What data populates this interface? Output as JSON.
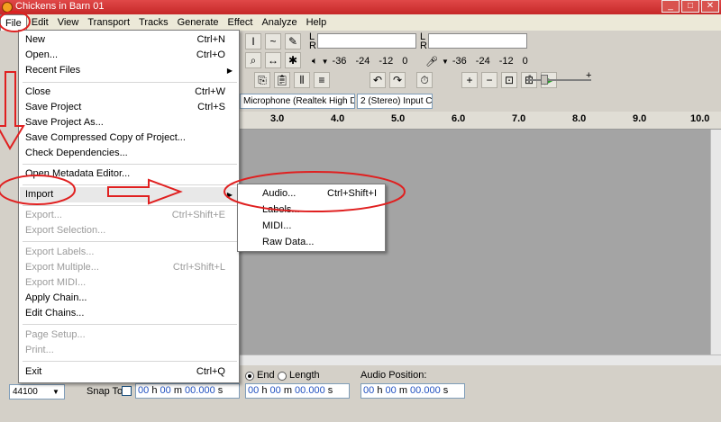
{
  "window": {
    "title": "Chickens in Barn 01",
    "buttons": [
      "_",
      "□",
      "✕"
    ]
  },
  "menubar": [
    "File",
    "Edit",
    "View",
    "Transport",
    "Tracks",
    "Generate",
    "Effect",
    "Analyze",
    "Help"
  ],
  "file_menu": {
    "items": [
      {
        "label": "New",
        "shortcut": "Ctrl+N",
        "enabled": true
      },
      {
        "label": "Open...",
        "shortcut": "Ctrl+O",
        "enabled": true
      },
      {
        "label": "Recent Files",
        "shortcut": "",
        "enabled": true,
        "submenu": true
      },
      {
        "label": "Close",
        "shortcut": "Ctrl+W",
        "enabled": true
      },
      {
        "label": "Save Project",
        "shortcut": "Ctrl+S",
        "enabled": true
      },
      {
        "label": "Save Project As...",
        "shortcut": "",
        "enabled": true
      },
      {
        "label": "Save Compressed Copy of Project...",
        "shortcut": "",
        "enabled": true
      },
      {
        "label": "Check Dependencies...",
        "shortcut": "",
        "enabled": true
      },
      {
        "label": "Open Metadata Editor...",
        "shortcut": "",
        "enabled": true
      },
      {
        "label": "Import",
        "shortcut": "",
        "enabled": true,
        "submenu": true
      },
      {
        "label": "Export...",
        "shortcut": "Ctrl+Shift+E",
        "enabled": false
      },
      {
        "label": "Export Selection...",
        "shortcut": "",
        "enabled": false
      },
      {
        "label": "Export Labels...",
        "shortcut": "",
        "enabled": false
      },
      {
        "label": "Export Multiple...",
        "shortcut": "Ctrl+Shift+L",
        "enabled": false
      },
      {
        "label": "Export MIDI...",
        "shortcut": "",
        "enabled": false
      },
      {
        "label": "Apply Chain...",
        "shortcut": "",
        "enabled": true
      },
      {
        "label": "Edit Chains...",
        "shortcut": "",
        "enabled": true
      },
      {
        "label": "Page Setup...",
        "shortcut": "",
        "enabled": false
      },
      {
        "label": "Print...",
        "shortcut": "",
        "enabled": false
      },
      {
        "label": "Exit",
        "shortcut": "Ctrl+Q",
        "enabled": true
      }
    ]
  },
  "import_submenu": [
    {
      "label": "Audio...",
      "shortcut": "Ctrl+Shift+I"
    },
    {
      "label": "Labels...",
      "shortcut": ""
    },
    {
      "label": "MIDI...",
      "shortcut": ""
    },
    {
      "label": "Raw Data...",
      "shortcut": ""
    }
  ],
  "toolbar": {
    "meter_L": "L",
    "meter_R": "R",
    "db_ticks_play": [
      "-36",
      "-24",
      "-12",
      "0"
    ],
    "db_ticks_rec": [
      "-36",
      "-24",
      "-12",
      "0"
    ],
    "input_device": "Microphone (Realtek High Defi",
    "input_channels": "2 (Stereo) Input C",
    "slider_minus": "-",
    "slider_plus": "+"
  },
  "ruler": {
    "ticks": [
      "3.0",
      "4.0",
      "5.0",
      "6.0",
      "7.0",
      "8.0",
      "9.0",
      "10.0"
    ]
  },
  "statusbar": {
    "project_rate": "44100",
    "snap_to_label": "Snap To",
    "end_label": "End",
    "length_label": "Length",
    "audio_position_label": "Audio Position:",
    "timecode": {
      "h": "00",
      "h_unit": "h",
      "m": "00",
      "m_unit": "m",
      "s": "00.000",
      "s_unit": "s"
    }
  },
  "annotation_colors": {
    "circle": "#e02020",
    "arrow": "#e02020"
  }
}
